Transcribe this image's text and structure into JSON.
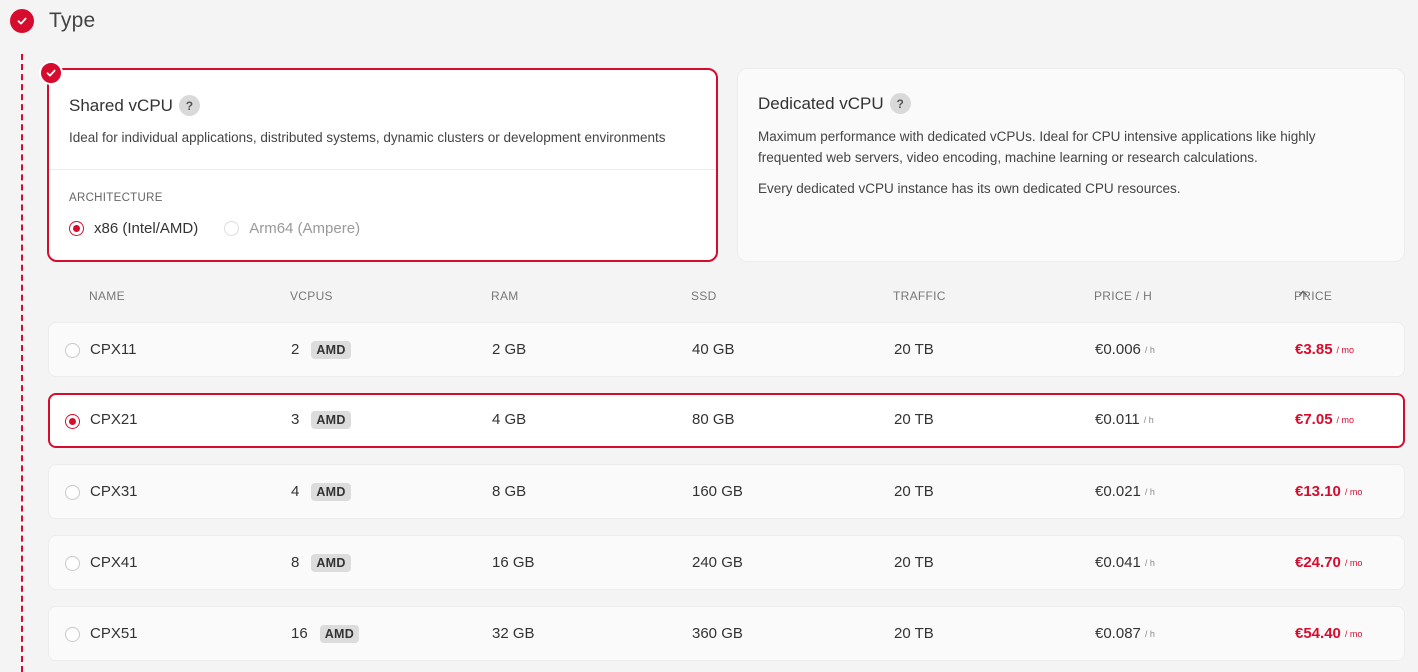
{
  "section": {
    "title": "Type"
  },
  "colors": {
    "accent": "#d50c2d"
  },
  "cards": {
    "shared": {
      "title": "Shared vCPU",
      "help": "?",
      "description": "Ideal for individual applications, distributed systems, dynamic clusters or development environments",
      "architecture_label": "ARCHITECTURE",
      "options": [
        {
          "label": "x86 (Intel/AMD)",
          "checked": true
        },
        {
          "label": "Arm64 (Ampere)",
          "checked": false
        }
      ]
    },
    "dedicated": {
      "title": "Dedicated vCPU",
      "help": "?",
      "description1": "Maximum performance with dedicated vCPUs. Ideal for CPU intensive applications like highly frequented web servers, video encoding, machine learning or research calculations.",
      "description2": "Every dedicated vCPU instance has its own dedicated CPU resources."
    }
  },
  "table": {
    "headers": {
      "name": "NAME",
      "vcpus": "VCPUS",
      "ram": "RAM",
      "ssd": "SSD",
      "traffic": "TRAFFIC",
      "price_h": "PRICE / H",
      "price": "PRICE"
    },
    "hour_unit": "/ h",
    "month_unit": "/ mo",
    "rows": [
      {
        "name": "CPX11",
        "vcpus": "2",
        "badge": "AMD",
        "ram": "2 GB",
        "ssd": "40 GB",
        "traffic": "20 TB",
        "price_h": "€0.006",
        "price": "€3.85"
      },
      {
        "name": "CPX21",
        "vcpus": "3",
        "badge": "AMD",
        "ram": "4 GB",
        "ssd": "80 GB",
        "traffic": "20 TB",
        "price_h": "€0.011",
        "price": "€7.05"
      },
      {
        "name": "CPX31",
        "vcpus": "4",
        "badge": "AMD",
        "ram": "8 GB",
        "ssd": "160 GB",
        "traffic": "20 TB",
        "price_h": "€0.021",
        "price": "€13.10"
      },
      {
        "name": "CPX41",
        "vcpus": "8",
        "badge": "AMD",
        "ram": "16 GB",
        "ssd": "240 GB",
        "traffic": "20 TB",
        "price_h": "€0.041",
        "price": "€24.70"
      },
      {
        "name": "CPX51",
        "vcpus": "16",
        "badge": "AMD",
        "ram": "32 GB",
        "ssd": "360 GB",
        "traffic": "20 TB",
        "price_h": "€0.087",
        "price": "€54.40"
      }
    ]
  }
}
